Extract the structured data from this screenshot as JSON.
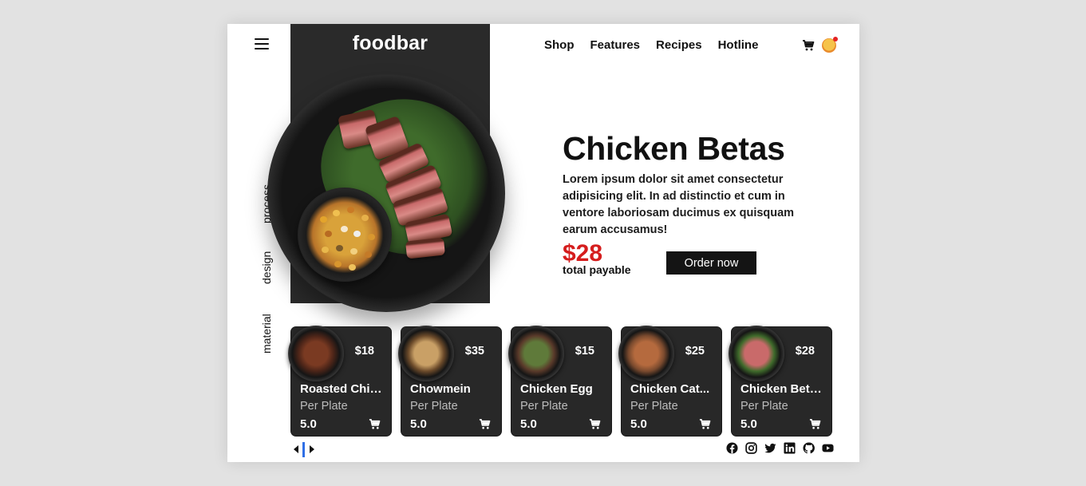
{
  "header": {
    "brand": "foodbar",
    "nav": [
      "Shop",
      "Features",
      "Recipes",
      "Hotline"
    ]
  },
  "side_tabs": [
    "process",
    "design",
    "material"
  ],
  "hero": {
    "title": "Chicken Betas",
    "description": "Lorem ipsum dolor sit amet consectetur adipisicing elit. In ad distinctio et cum in ventore laboriosam ducimus ex quisquam earum accusamus!",
    "price": "$28",
    "price_label": "total payable",
    "order_label": "Order now"
  },
  "products": [
    {
      "name": "Roasted Chicken",
      "price": "$18",
      "unit": "Per Plate",
      "rating": "5.0"
    },
    {
      "name": "Chowmein",
      "price": "$35",
      "unit": "Per Plate",
      "rating": "5.0"
    },
    {
      "name": "Chicken Egg",
      "price": "$15",
      "unit": "Per Plate",
      "rating": "5.0"
    },
    {
      "name": "Chicken Cat...",
      "price": "$25",
      "unit": "Per Plate",
      "rating": "5.0"
    },
    {
      "name": "Chicken Betas",
      "price": "$28",
      "unit": "Per Plate",
      "rating": "5.0"
    }
  ],
  "icons": {
    "menu": "menu-icon",
    "cart": "cart-icon",
    "avatar": "avatar-icon",
    "socials": [
      "facebook-icon",
      "instagram-icon",
      "twitter-icon",
      "linkedin-icon",
      "github-icon",
      "youtube-icon"
    ]
  },
  "colors": {
    "dark": "#2a2a2a",
    "price_red": "#d51d1d",
    "slider_accent": "#2f6fe6"
  }
}
